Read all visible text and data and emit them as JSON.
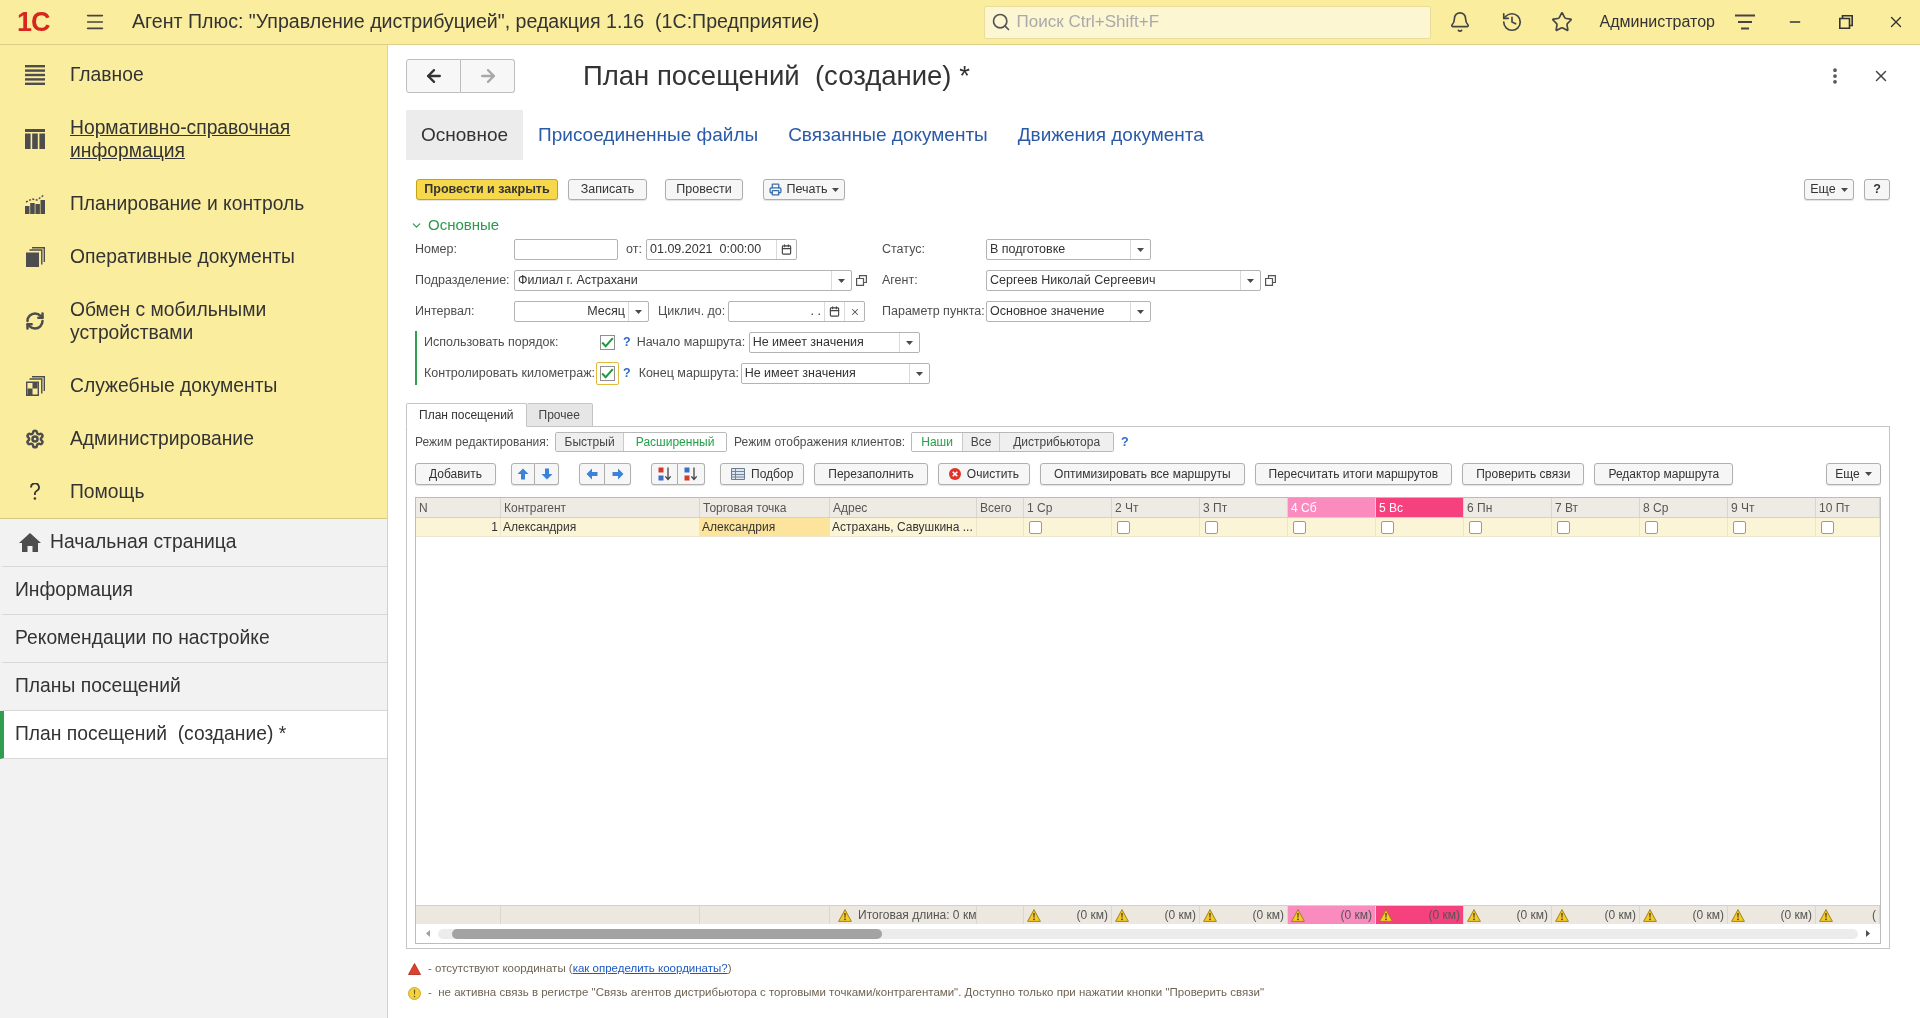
{
  "app_bar": {
    "logo": "1С",
    "title": "Агент Плюс: \"Управление дистрибуцией\", редакция 1.16  (1С:Предприятие)",
    "search": {
      "placeholder": "Поиск Ctrl+Shift+F"
    },
    "user": "Администратор"
  },
  "sidebar": {
    "sections": [
      {
        "label": "Главное",
        "hovered": false
      },
      {
        "label": "Нормативно-справочная информация",
        "hovered": true
      },
      {
        "label": "Планирование и контроль",
        "hovered": false
      },
      {
        "label": "Оперативные документы",
        "hovered": false
      },
      {
        "label": "Обмен с мобильными устройствами",
        "hovered": false
      },
      {
        "label": "Служебные документы",
        "hovered": false
      },
      {
        "label": "Администрирование",
        "hovered": false
      },
      {
        "label": "Помощь",
        "hovered": false
      }
    ],
    "open_windows": [
      {
        "kind": "home",
        "label": "Начальная страница",
        "selected": false
      },
      {
        "kind": "window",
        "label": "Информация",
        "selected": false
      },
      {
        "kind": "window",
        "label": "Рекомендации по настройке",
        "selected": false
      },
      {
        "kind": "window",
        "label": "Планы посещений",
        "selected": false
      },
      {
        "kind": "window",
        "label": "План посещений  (создание) *",
        "selected": true
      }
    ]
  },
  "form": {
    "navigation": {
      "back": {
        "disabled": false
      },
      "forward": {
        "disabled": true
      }
    },
    "title": "План посещений  (создание) *",
    "tabs": [
      {
        "label": "Основное",
        "selected": true
      },
      {
        "label": "Присоединенные файлы",
        "selected": false
      },
      {
        "label": "Связанные документы",
        "selected": false
      },
      {
        "label": "Движения документа",
        "selected": false
      }
    ],
    "commands": [
      {
        "kind": "primary",
        "label": "Провести и закрыть"
      },
      {
        "kind": "plain",
        "label": "Записать"
      },
      {
        "kind": "plain",
        "label": "Провести"
      },
      {
        "kind": "print",
        "label": "Печать"
      }
    ],
    "more": "Еще",
    "help": "?",
    "group": {
      "title": "Основные",
      "expanded": true
    },
    "fields": {
      "number": {
        "label": "Номер:"
      },
      "date": {
        "label": "от:",
        "value": "01.09.2021  0:00:00"
      },
      "status": {
        "label": "Статус:",
        "value": "В подготовке"
      },
      "division": {
        "label": "Подразделение:",
        "value": "Филиал г. Астрахани"
      },
      "agent": {
        "label": "Агент:",
        "value": "Сергеев Николай Сергеевич"
      },
      "interval": {
        "label": "Интервал:",
        "value": "Месяц"
      },
      "cycle_until": {
        "label": "Циклич. до:",
        "value": ". ."
      },
      "point_param": {
        "label": "Параметр пункта:",
        "value": "Основное значение"
      }
    },
    "flags": [
      {
        "label": "Использовать порядок:",
        "checked": true,
        "focused": false,
        "help": "?",
        "route_label": "Начало маршрута:",
        "route_value": "Не имеет значения"
      },
      {
        "label": "Контролировать километраж:",
        "checked": true,
        "focused": true,
        "help": "?",
        "route_label": "Конец маршрута:",
        "route_value": "Не имеет значения"
      }
    ],
    "plan": {
      "tabs": [
        {
          "label": "План посещений",
          "selected": true
        },
        {
          "label": "Прочее",
          "selected": false
        }
      ],
      "edit_mode": {
        "label": "Режим редактирования:",
        "options": [
          {
            "label": "Быстрый",
            "selected": false
          },
          {
            "label": "Расширенный",
            "selected": true
          }
        ]
      },
      "client_mode": {
        "label": "Режим отображения клиентов:",
        "options": [
          {
            "label": "Наши",
            "selected": true
          },
          {
            "label": "Все",
            "selected": false
          },
          {
            "label": "Дистрибьютора",
            "selected": false
          }
        ],
        "help": "?"
      },
      "toolbar": [
        {
          "kind": "text",
          "label": "Добавить"
        },
        {
          "kind": "move-vertical"
        },
        {
          "kind": "move-horizontal"
        },
        {
          "kind": "sort"
        },
        {
          "kind": "pick",
          "label": "Подбор"
        },
        {
          "kind": "text",
          "label": "Перезаполнить"
        },
        {
          "kind": "clear",
          "label": "Очистить"
        },
        {
          "kind": "text",
          "label": "Оптимизировать все маршруты"
        },
        {
          "kind": "text",
          "label": "Пересчитать итоги маршрутов"
        },
        {
          "kind": "text",
          "label": "Проверить связи"
        },
        {
          "kind": "text",
          "label": "Редактор маршрута"
        }
      ],
      "toolbar_more": "Еще",
      "table": {
        "columns": [
          {
            "kind": "number",
            "label": "N"
          },
          {
            "kind": "text",
            "label": "Контрагент"
          },
          {
            "kind": "text",
            "label": "Торговая точка"
          },
          {
            "kind": "text",
            "label": "Адрес"
          },
          {
            "kind": "total",
            "label": "Всего"
          },
          {
            "kind": "day",
            "label": "1 Ср"
          },
          {
            "kind": "day",
            "label": "2 Чт"
          },
          {
            "kind": "day",
            "label": "3 Пт"
          },
          {
            "kind": "day",
            "label": "4 Сб",
            "color": "#f98bbf"
          },
          {
            "kind": "day",
            "label": "5 Вс",
            "color": "#f5427f"
          },
          {
            "kind": "day",
            "label": "6 Пн"
          },
          {
            "kind": "day",
            "label": "7 Вт"
          },
          {
            "kind": "day",
            "label": "8 Ср"
          },
          {
            "kind": "day",
            "label": "9 Чт"
          },
          {
            "kind": "day",
            "label": "10 Пт"
          }
        ],
        "rows": [
          {
            "selected": true,
            "cells": [
              {
                "text": "1",
                "current": false
              },
              {
                "text": "Александрия",
                "current": false
              },
              {
                "text": "Александрия",
                "current": true
              },
              {
                "text": "Астрахань, Савушкина ...",
                "current": false
              }
            ],
            "days": [
              {
                "checked": false
              },
              {
                "checked": false
              },
              {
                "checked": false
              },
              {
                "checked": false
              },
              {
                "checked": false
              },
              {
                "checked": false
              },
              {
                "checked": false
              },
              {
                "checked": false
              },
              {
                "checked": false
              },
              {
                "checked": false
              }
            ]
          }
        ],
        "footer": {
          "total_length": "Итоговая длина: 0 км",
          "days": [
            {
              "text": "(0 км)"
            },
            {
              "text": "(0 км)"
            },
            {
              "text": "(0 км)"
            },
            {
              "text": "(0 км)"
            },
            {
              "text": "(0 км)"
            },
            {
              "text": "(0 км)"
            },
            {
              "text": "(0 км)"
            },
            {
              "text": "(0 км)"
            },
            {
              "text": "(0 км)"
            },
            {
              "text": "("
            }
          ]
        }
      }
    },
    "legend": [
      {
        "kind": "missing-coordinates",
        "text": "- отсутствуют координаты (",
        "link": "как определить координаты?",
        "after": ")"
      },
      {
        "kind": "inactive-link",
        "text": "-  не активна связь в регистре \"Связь агентов дистрибьютора с торговыми точками/контрагентами\". Доступно только при нажатии кнопки \"Проверить связи\""
      }
    ]
  }
}
